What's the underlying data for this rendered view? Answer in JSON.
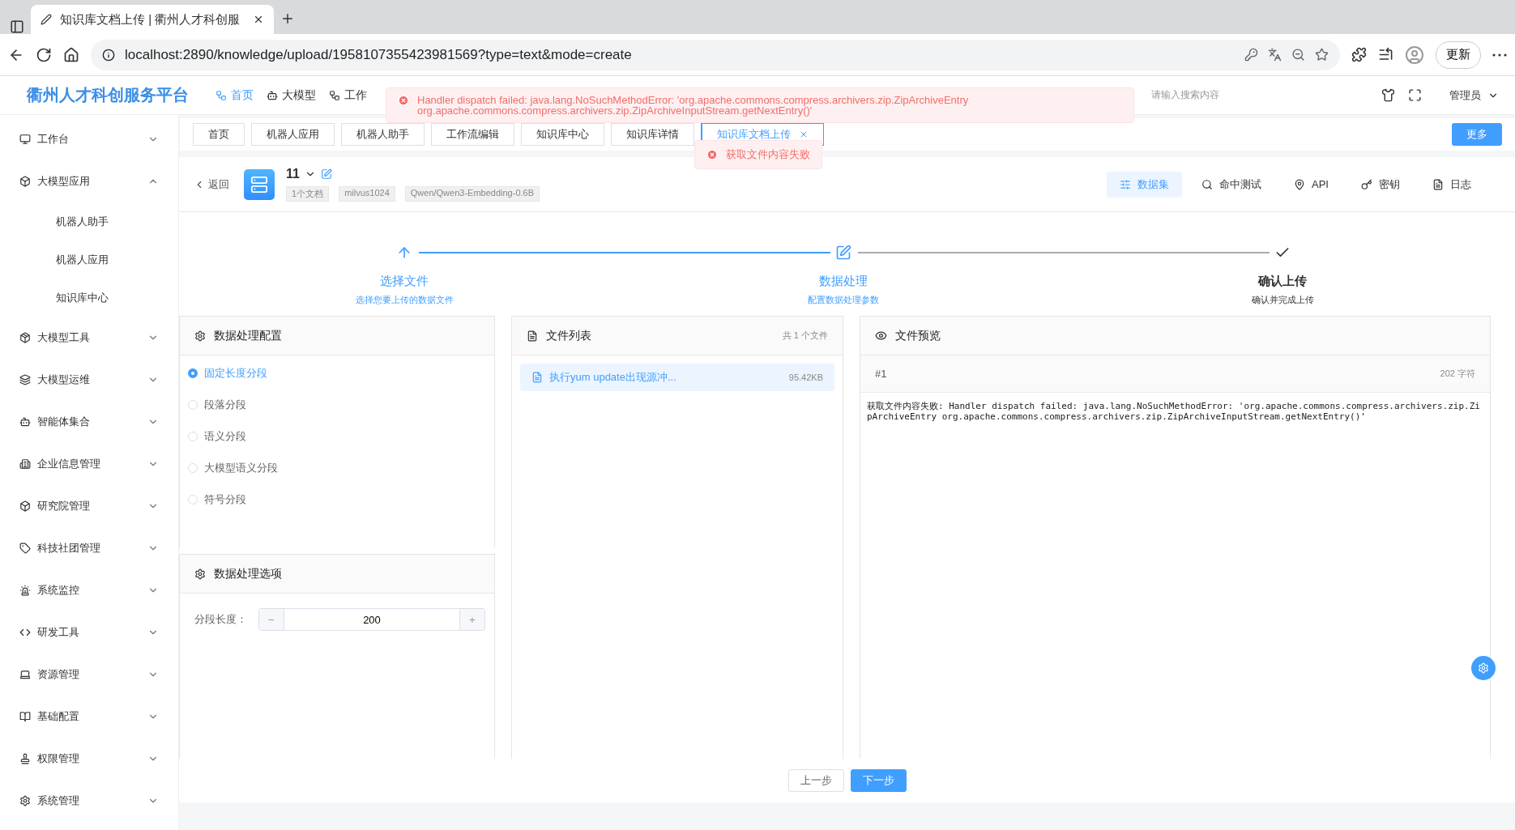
{
  "browser": {
    "tab_title": "知识库文档上传 | 衢州人才科创服",
    "url": "localhost:2890/knowledge/upload/1958107355423981569?type=text&mode=create",
    "update_button": "更新"
  },
  "header": {
    "logo": "衢州人才科创服务平台",
    "nav": [
      {
        "label": "首页",
        "selected": true
      },
      {
        "label": "大模型",
        "selected": false
      },
      {
        "label": "工作",
        "selected": false
      }
    ],
    "search": {
      "placeholder": "请输入搜索内容"
    },
    "user": "管理员"
  },
  "sidebar": {
    "items": [
      {
        "label": "工作台",
        "expanded": false
      },
      {
        "label": "大模型应用",
        "expanded": true,
        "children": [
          {
            "label": "机器人助手"
          },
          {
            "label": "机器人应用"
          },
          {
            "label": "知识库中心"
          }
        ]
      },
      {
        "label": "大模型工具",
        "expanded": false
      },
      {
        "label": "大模型运维",
        "expanded": false
      },
      {
        "label": "智能体集合",
        "expanded": false
      },
      {
        "label": "企业信息管理",
        "expanded": false
      },
      {
        "label": "研究院管理",
        "expanded": false
      },
      {
        "label": "科技社团管理",
        "expanded": false
      },
      {
        "label": "系统监控",
        "expanded": false
      },
      {
        "label": "研发工具",
        "expanded": false
      },
      {
        "label": "资源管理",
        "expanded": false
      },
      {
        "label": "基础配置",
        "expanded": false
      },
      {
        "label": "权限管理",
        "expanded": false
      },
      {
        "label": "系统管理",
        "expanded": false
      }
    ]
  },
  "tabs": [
    {
      "label": "首页",
      "selected": false
    },
    {
      "label": "机器人应用",
      "selected": false
    },
    {
      "label": "机器人助手",
      "selected": false
    },
    {
      "label": "工作流编辑",
      "selected": false
    },
    {
      "label": "知识库中心",
      "selected": false
    },
    {
      "label": "知识库详情",
      "selected": false
    },
    {
      "label": "知识库文档上传",
      "selected": true
    }
  ],
  "more_button": "更多",
  "knowledge_base": {
    "back": "返回",
    "name": "11",
    "tags": [
      "1个文档",
      "milvus1024",
      "Qwen/Qwen3-Embedding-0.6B"
    ]
  },
  "actions": [
    {
      "label": "数据集",
      "selected": true
    },
    {
      "label": "命中测试",
      "selected": false
    },
    {
      "label": "API",
      "selected": false
    },
    {
      "label": "密钥",
      "selected": false
    },
    {
      "label": "日志",
      "selected": false
    }
  ],
  "steps": [
    {
      "title": "选择文件",
      "description": "选择您要上传的数据文件",
      "completed": true
    },
    {
      "title": "数据处理",
      "description": "配置数据处理参数",
      "completed": true
    },
    {
      "title": "确认上传",
      "description": "确认并完成上传",
      "completed": false
    }
  ],
  "config_panel": {
    "title": "数据处理配置",
    "options": [
      {
        "label": "固定长度分段",
        "selected": true
      },
      {
        "label": "段落分段",
        "selected": false
      },
      {
        "label": "语义分段",
        "selected": false
      },
      {
        "label": "大模型语义分段",
        "selected": false
      },
      {
        "label": "符号分段",
        "selected": false
      }
    ]
  },
  "options_panel": {
    "title": "数据处理选项",
    "field_label": "分段长度：",
    "value": "200",
    "minus": "−",
    "plus": "+"
  },
  "file_panel": {
    "title": "文件列表",
    "count": "共 1 个文件",
    "files": [
      {
        "name": "执行yum update出现源冲...",
        "size": "95.42KB",
        "selected": true
      }
    ]
  },
  "preview_panel": {
    "title": "文件预览",
    "chunk": "#1",
    "chars": "202 字符",
    "content": "获取文件内容失败: Handler dispatch failed: java.lang.NoSuchMethodError: 'org.apache.commons.compress.archivers.zip.ZipArchiveEntry org.apache.commons.compress.archivers.zip.ZipArchiveInputStream.getNextEntry()'"
  },
  "footer": {
    "prev": "上一步",
    "next": "下一步"
  },
  "toasts": [
    {
      "message": "Handler dispatch failed: java.lang.NoSuchMethodError: 'org.apache.commons.compress.archivers.zip.ZipArchiveEntry org.apache.commons.compress.archivers.zip.ZipArchiveInputStream.getNextEntry()'",
      "kind": "error"
    },
    {
      "message": "获取文件内容失败",
      "kind": "error"
    }
  ]
}
